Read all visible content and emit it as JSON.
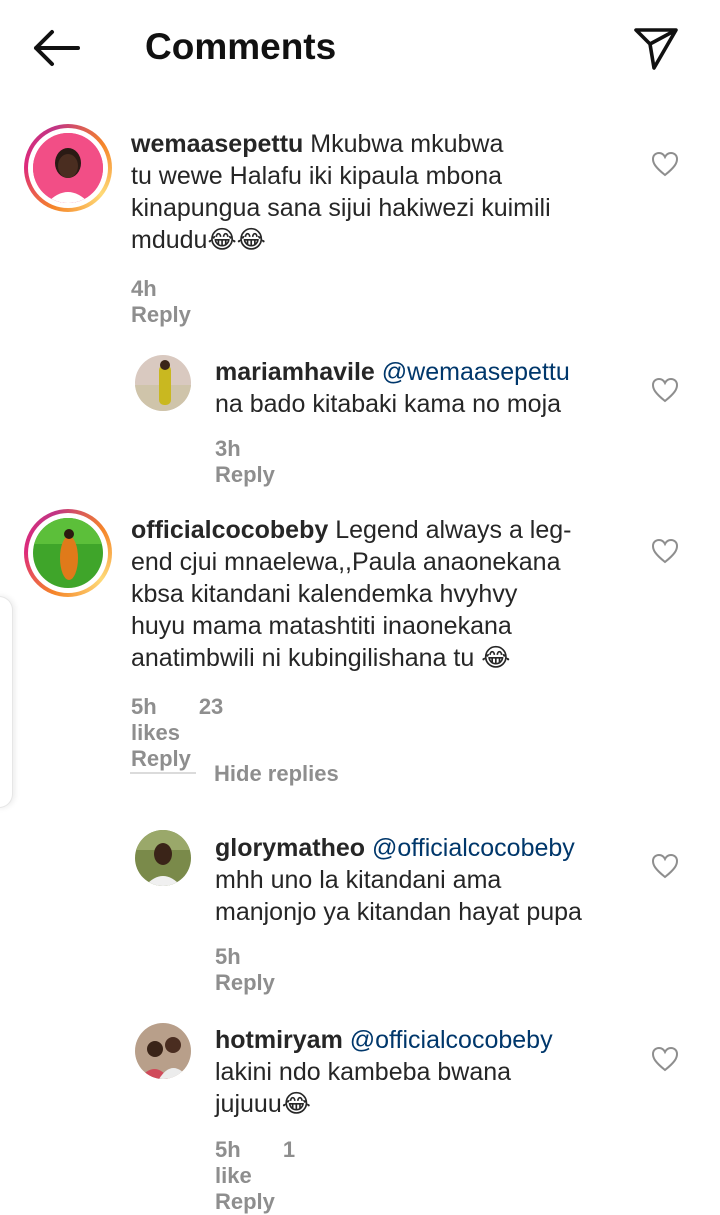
{
  "header": {
    "title": "Comments"
  },
  "hide_replies": "Hide replies",
  "comments": [
    {
      "username": "wemaasepettu",
      "mention": "",
      "lines": [
        "Mkubwa mkubwa",
        "tu wewe Halafu iki kipaula mbona",
        "kinapungua sana sijui hakiwezi kuimili",
        "mdudu😂😂"
      ],
      "time": "4h",
      "likes": "",
      "reply": "Reply"
    },
    {
      "username": "mariamhavile",
      "mention": "@wemaasepettu",
      "lines": [
        "",
        "na bado kitabaki kama no moja"
      ],
      "time": "3h",
      "likes": "",
      "reply": "Reply"
    },
    {
      "username": "officialcocobeby",
      "mention": "",
      "lines": [
        "Legend always a leg-",
        "end cjui mnaelewa,,Paula anaonekana",
        "kbsa kitandani kalendemka hvyhvy",
        "huyu mama matashtiti inaonekana",
        "anatimbwili ni kubingilishana tu 😂"
      ],
      "time": "5h",
      "likes": "23 likes",
      "reply": "Reply"
    },
    {
      "username": "glorymatheo",
      "mention": "@officialcocobeby",
      "lines": [
        "",
        "mhh uno la kitandani ama",
        "manjonjo ya kitandan hayat pupa"
      ],
      "time": "5h",
      "likes": "",
      "reply": "Reply"
    },
    {
      "username": "hotmiryam",
      "mention": "@officialcocobeby",
      "lines": [
        "",
        "lakini ndo kambeba bwana",
        "jujuuu😂"
      ],
      "time": "5h",
      "likes": "1 like",
      "reply": "Reply"
    }
  ]
}
